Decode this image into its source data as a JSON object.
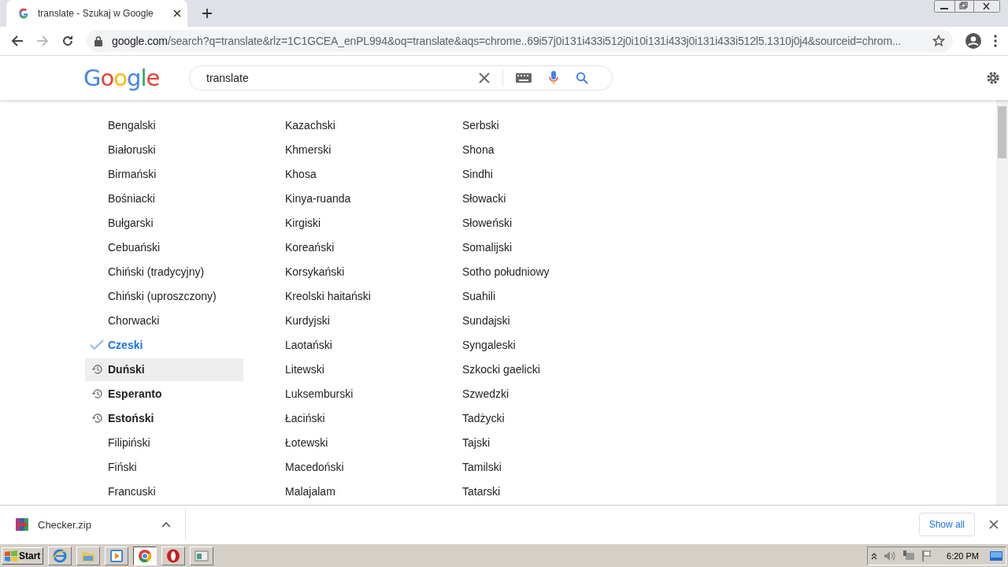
{
  "browser": {
    "tabs": [
      {
        "title": "translate - Szukaj w Google",
        "selected": true
      }
    ],
    "address": {
      "domain": "google.com",
      "path": "/search?q=translate&rlz=1C1GCEA_enPL994&oq=translate&aqs=chrome..69i57j0i131i433i512j0i10i131i433j0i131i433i512l5.1310j0j4&sourceid=chrom..."
    }
  },
  "search": {
    "logo": "Google",
    "value": "translate"
  },
  "languages": {
    "columns": [
      {
        "items": [
          {
            "name": "Bengalski",
            "selected": false,
            "recent": false,
            "hovered": false
          },
          {
            "name": "Białoruski",
            "selected": false,
            "recent": false,
            "hovered": false
          },
          {
            "name": "Birmański",
            "selected": false,
            "recent": false,
            "hovered": false
          },
          {
            "name": "Bośniacki",
            "selected": false,
            "recent": false,
            "hovered": false
          },
          {
            "name": "Bułgarski",
            "selected": false,
            "recent": false,
            "hovered": false
          },
          {
            "name": "Cebuański",
            "selected": false,
            "recent": false,
            "hovered": false
          },
          {
            "name": "Chiński (tradycyjny)",
            "selected": false,
            "recent": false,
            "hovered": false
          },
          {
            "name": "Chiński (uproszczony)",
            "selected": false,
            "recent": false,
            "hovered": false
          },
          {
            "name": "Chorwacki",
            "selected": false,
            "recent": false,
            "hovered": false
          },
          {
            "name": "Czeski",
            "selected": true,
            "recent": false,
            "hovered": false
          },
          {
            "name": "Duński",
            "selected": false,
            "recent": true,
            "hovered": true
          },
          {
            "name": "Esperanto",
            "selected": false,
            "recent": true,
            "hovered": false
          },
          {
            "name": "Estoński",
            "selected": false,
            "recent": true,
            "hovered": false
          },
          {
            "name": "Filipiński",
            "selected": false,
            "recent": false,
            "hovered": false
          },
          {
            "name": "Fiński",
            "selected": false,
            "recent": false,
            "hovered": false
          },
          {
            "name": "Francuski",
            "selected": false,
            "recent": false,
            "hovered": false
          }
        ]
      },
      {
        "items": [
          {
            "name": "Kazachski",
            "selected": false,
            "recent": false,
            "hovered": false
          },
          {
            "name": "Khmerski",
            "selected": false,
            "recent": false,
            "hovered": false
          },
          {
            "name": "Khosa",
            "selected": false,
            "recent": false,
            "hovered": false
          },
          {
            "name": "Kinya-ruanda",
            "selected": false,
            "recent": false,
            "hovered": false
          },
          {
            "name": "Kirgiski",
            "selected": false,
            "recent": false,
            "hovered": false
          },
          {
            "name": "Koreański",
            "selected": false,
            "recent": false,
            "hovered": false
          },
          {
            "name": "Korsykański",
            "selected": false,
            "recent": false,
            "hovered": false
          },
          {
            "name": "Kreolski haitański",
            "selected": false,
            "recent": false,
            "hovered": false
          },
          {
            "name": "Kurdyjski",
            "selected": false,
            "recent": false,
            "hovered": false
          },
          {
            "name": "Laotański",
            "selected": false,
            "recent": false,
            "hovered": false
          },
          {
            "name": "Litewski",
            "selected": false,
            "recent": false,
            "hovered": false
          },
          {
            "name": "Luksemburski",
            "selected": false,
            "recent": false,
            "hovered": false
          },
          {
            "name": "Łaciński",
            "selected": false,
            "recent": false,
            "hovered": false
          },
          {
            "name": "Łotewski",
            "selected": false,
            "recent": false,
            "hovered": false
          },
          {
            "name": "Macedoński",
            "selected": false,
            "recent": false,
            "hovered": false
          },
          {
            "name": "Malajalam",
            "selected": false,
            "recent": false,
            "hovered": false
          }
        ]
      },
      {
        "items": [
          {
            "name": "Serbski",
            "selected": false,
            "recent": false,
            "hovered": false
          },
          {
            "name": "Shona",
            "selected": false,
            "recent": false,
            "hovered": false
          },
          {
            "name": "Sindhi",
            "selected": false,
            "recent": false,
            "hovered": false
          },
          {
            "name": "Słowacki",
            "selected": false,
            "recent": false,
            "hovered": false
          },
          {
            "name": "Słoweński",
            "selected": false,
            "recent": false,
            "hovered": false
          },
          {
            "name": "Somalijski",
            "selected": false,
            "recent": false,
            "hovered": false
          },
          {
            "name": "Sotho południowy",
            "selected": false,
            "recent": false,
            "hovered": false
          },
          {
            "name": "Suahili",
            "selected": false,
            "recent": false,
            "hovered": false
          },
          {
            "name": "Sundajski",
            "selected": false,
            "recent": false,
            "hovered": false
          },
          {
            "name": "Syngaleski",
            "selected": false,
            "recent": false,
            "hovered": false
          },
          {
            "name": "Szkocki gaelicki",
            "selected": false,
            "recent": false,
            "hovered": false
          },
          {
            "name": "Szwedzki",
            "selected": false,
            "recent": false,
            "hovered": false
          },
          {
            "name": "Tadżycki",
            "selected": false,
            "recent": false,
            "hovered": false
          },
          {
            "name": "Tajski",
            "selected": false,
            "recent": false,
            "hovered": false
          },
          {
            "name": "Tamilski",
            "selected": false,
            "recent": false,
            "hovered": false
          },
          {
            "name": "Tatarski",
            "selected": false,
            "recent": false,
            "hovered": false
          }
        ]
      }
    ]
  },
  "downloads": {
    "items": [
      {
        "file": "Checker.zip"
      }
    ],
    "show_all": "Show all"
  },
  "taskbar": {
    "start": "Start",
    "clock": "6:20 PM"
  }
}
